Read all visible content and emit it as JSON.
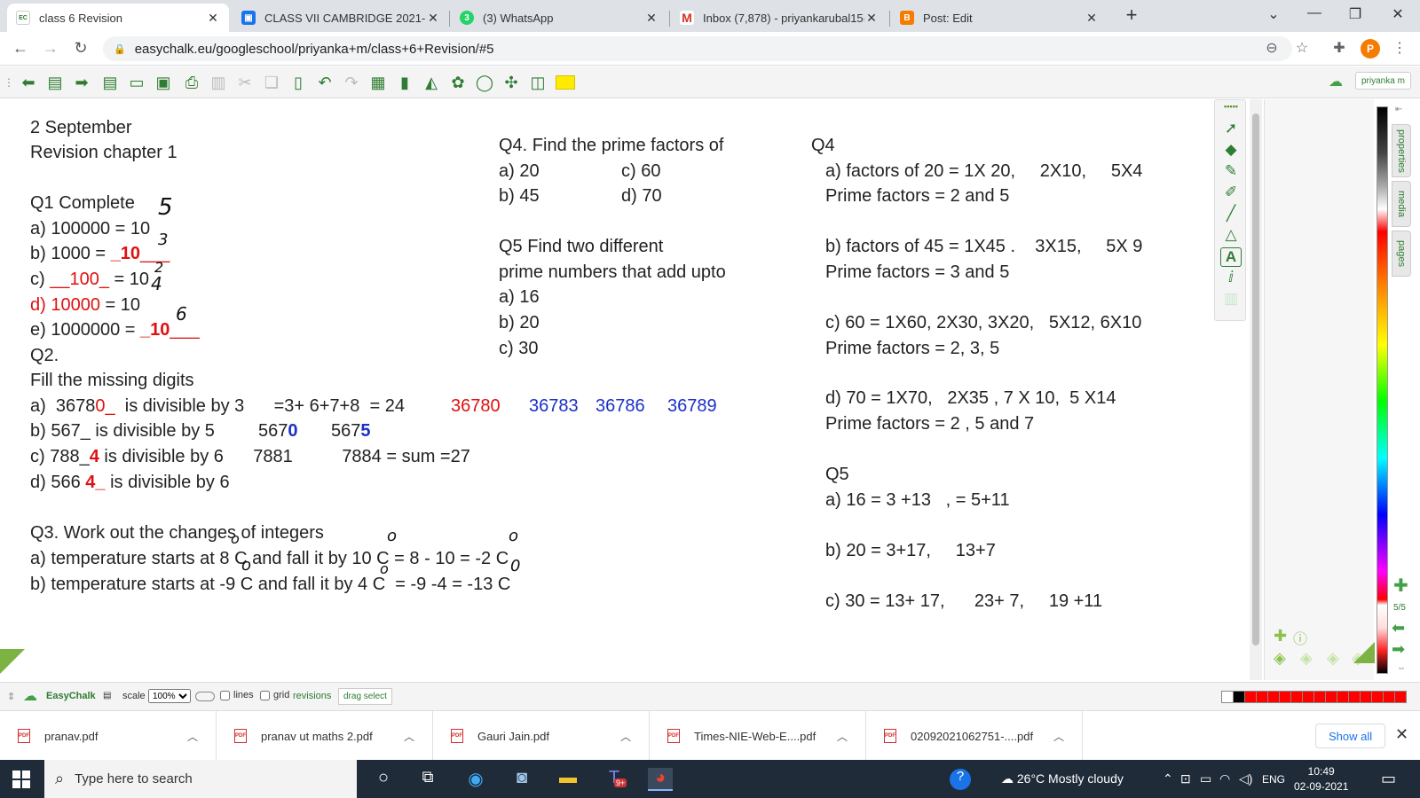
{
  "browser": {
    "tabs": [
      {
        "label": "class 6 Revision",
        "icon": "easychalk-icon",
        "active": true
      },
      {
        "label": "CLASS VII CAMBRIDGE 2021-22 /",
        "icon": "classroom-icon"
      },
      {
        "label": "(3) WhatsApp",
        "icon": "whatsapp-icon"
      },
      {
        "label": "Inbox (7,878) - priyankarubal15@",
        "icon": "gmail-icon"
      },
      {
        "label": "Post: Edit",
        "icon": "blogger-icon"
      }
    ],
    "new_tab": "+",
    "url": "easychalk.eu/googleschool/priyanka+m/class+6+Revision/#5",
    "profile_initial": "P"
  },
  "app": {
    "user": "priyanka m",
    "logo": "EasyChalk",
    "scale_label": "scale",
    "scale_value": "100%",
    "lines_label": "lines",
    "grid_label": "grid",
    "revisions_label": "revisions",
    "drag_select_label": "drag select",
    "side_tabs": [
      "properties",
      "media",
      "pages"
    ],
    "page_indicator": "5/5"
  },
  "board": {
    "left": {
      "l1": "2 September",
      "l2": "Revision chapter 1",
      "q1": "Q1 Complete",
      "q1a": "a) 100000 = 10",
      "q1b_pre": "b) 1000 = ",
      "q1b_ans": "_10",
      "q1b_post": "___",
      "q1c_pre": "c) ",
      "q1c_ans": "__100_",
      "q1c_post": " = 10",
      "q1d_ans": "d) 10000",
      "q1d_post": " = 10",
      "q1e_pre": "e) 1000000 = ",
      "q1e_ans": "_10",
      "q1e_post": "___",
      "q2": "Q2.",
      "q2_title": "Fill the missing digits",
      "q2a_pre": "a)  3678",
      "q2a_ans": "0_",
      "q2a_post": "  is divisible by 3      =3+ 6+7+8  = 24",
      "q2a_vals": [
        "36780",
        "36783",
        "36786",
        "36789"
      ],
      "q2b_pre": "b) 567_ is divisible by 5",
      "q2b_v1": "567",
      "q2b_v1b": "0",
      "q2b_v2": "567",
      "q2b_v2b": "5",
      "q2c_pre": "c) 788_",
      "q2c_ans": "4",
      "q2c_post": " is divisible by 6      7881          7884 = sum =27",
      "q2d_pre": "d) 566 ",
      "q2d_ans": "4_",
      "q2d_post": " is divisible by 6",
      "q3": "Q3. Work out the changes of integers",
      "q3a": "a) temperature starts at 8 C and fall it by 10 C = 8 - 10 = -2 C",
      "q3b": "b) temperature starts at -9 C and fall it by 4 C  = -9 -4 = -13 C",
      "hw_marks": [
        "5",
        "3",
        "2",
        "4",
        "6",
        "o",
        "o",
        "o",
        "o",
        "o",
        "0"
      ]
    },
    "middle": {
      "q4": "Q4. Find the prime factors of",
      "q4a": "a) 20",
      "q4c": "c) 60",
      "q4b": "b) 45",
      "q4d": "d) 70",
      "q5_l1": "Q5 Find two different",
      "q5_l2": "prime numbers that add upto",
      "q5a": "a) 16",
      "q5b": "b) 20",
      "q5c": "c) 30"
    },
    "right": {
      "h4": "Q4",
      "a1": "a) factors of 20 = 1X 20,     2X10,     5X4",
      "a2": "Prime factors = 2 and 5",
      "b1": "b) factors of 45 = 1X45 .    3X15,     5X 9",
      "b2": "Prime factors = 3 and 5",
      "c1": "c) 60 = 1X60, 2X30, 3X20,   5X12, 6X10",
      "c2": "Prime factors = 2, 3, 5",
      "d1": "d) 70 = 1X70,   2X35 , 7 X 10,  5 X14",
      "d2": "Prime factors = 2 , 5 and 7",
      "h5": "Q5",
      "q5a": "a) 16 = 3 +13   , = 5+11",
      "q5b": "b) 20 = 3+17,     13+7",
      "q5c": "c) 30 = 13+ 17,      23+ 7,     19 +11"
    }
  },
  "downloads": {
    "items": [
      "pranav.pdf",
      "pranav ut maths 2.pdf",
      "Gauri Jain.pdf",
      "Times-NIE-Web-E....pdf",
      "02092021062751-....pdf"
    ],
    "show_all": "Show all"
  },
  "taskbar": {
    "search_placeholder": "Type here to search",
    "weather": "26°C  Mostly cloudy",
    "lang": "ENG",
    "time": "10:49",
    "date": "02-09-2021",
    "teams_badge": "9+"
  },
  "colors": {
    "accent_green": "#2e7d32",
    "answer_red": "#e01010",
    "answer_blue": "#1a30c8"
  }
}
